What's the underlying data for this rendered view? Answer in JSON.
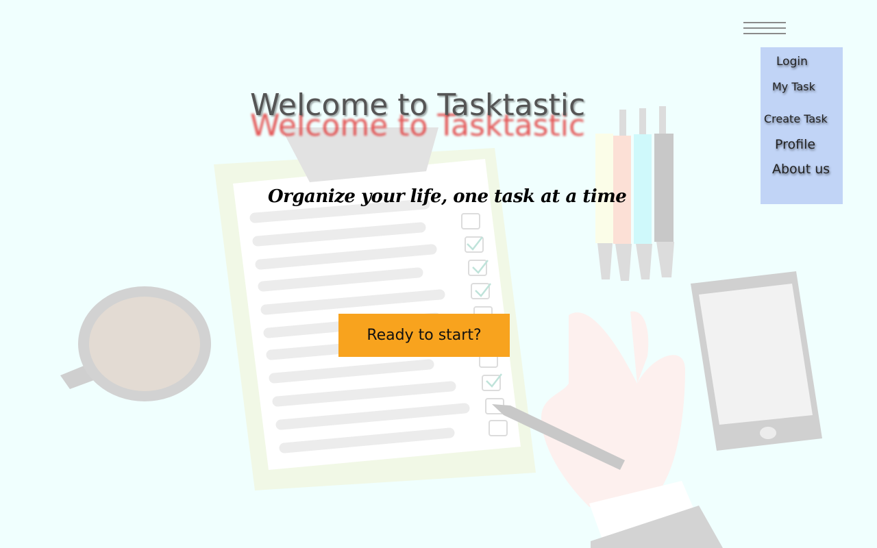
{
  "hero": {
    "title": "Welcome to Tasktastic",
    "subtitle": "Organize your life, one task at a time",
    "cta_label": "Ready to start?"
  },
  "menu": {
    "items": [
      {
        "label": "Login"
      },
      {
        "label": "My Task"
      },
      {
        "label": "Create Task"
      },
      {
        "label": "Profile"
      },
      {
        "label": "About us"
      }
    ]
  },
  "colors": {
    "page_background": "#f0fffe",
    "menu_background": "#c1d4f6",
    "cta_background": "#f8a31e",
    "title_echo": "#e23c3c"
  },
  "icons": [
    "hamburger-menu-icon"
  ]
}
